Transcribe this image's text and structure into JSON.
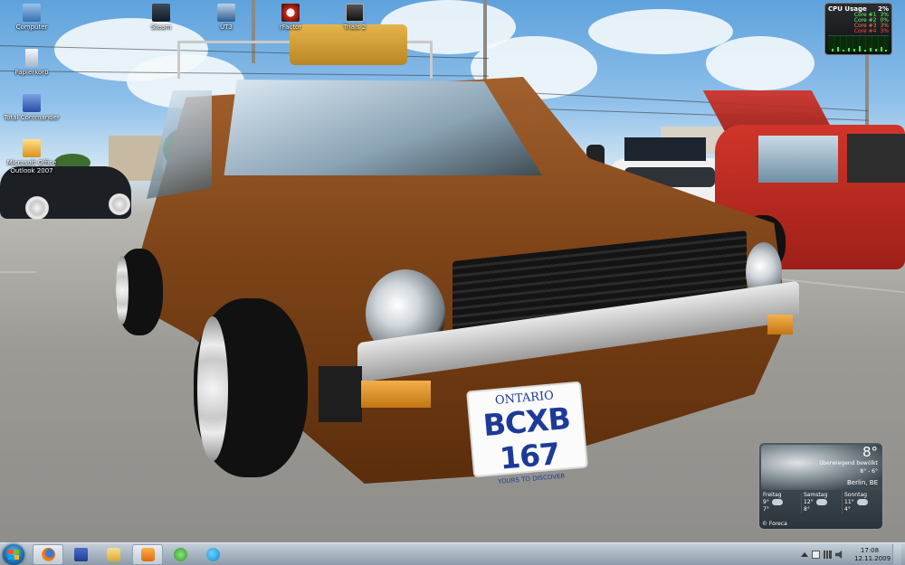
{
  "desktop": {
    "icons": [
      {
        "label": "Computer",
        "icon": "computer-icon",
        "color": "#4c86c9"
      },
      {
        "label": "Steam",
        "icon": "steam-icon",
        "color": "#1b2838"
      },
      {
        "label": "UT3",
        "icon": "ut3-icon",
        "color": "#2d5c8f"
      },
      {
        "label": "rFactor",
        "icon": "rfactor-icon",
        "color": "#c8261b"
      },
      {
        "label": "Trials 2",
        "icon": "trials2-icon",
        "color": "#222222"
      },
      {
        "label": "Papierkorb",
        "icon": "recycle-bin-icon",
        "color": "#cfd8e2"
      },
      {
        "label": "Total Commander",
        "icon": "total-commander-icon",
        "color": "#3c63b8"
      },
      {
        "label": "Microsoft Office Outlook 2007",
        "icon": "outlook-icon",
        "color": "#e3a523"
      }
    ]
  },
  "cpu_gadget": {
    "title": "CPU Usage",
    "total": "2%",
    "cores": [
      {
        "label": "Core #1",
        "value": "3%"
      },
      {
        "label": "Core #2",
        "value": "0%"
      },
      {
        "label": "Core #3",
        "value": "3%"
      },
      {
        "label": "Core #4",
        "value": "3%"
      }
    ]
  },
  "weather": {
    "temperature": "8°",
    "description": "überwiegend bewölkt",
    "range": "8° - 6°",
    "city": "Berlin, BE",
    "days": [
      {
        "name": "Freitag",
        "high": "9°",
        "low": "7°"
      },
      {
        "name": "Samstag",
        "high": "12°",
        "low": "8°"
      },
      {
        "name": "Sonntag",
        "high": "11°",
        "low": "4°"
      }
    ],
    "provider": "© Foreca"
  },
  "wallpaper": {
    "plate_top": "ONTARIO",
    "plate_number": "BCXB 167",
    "plate_slogan": "YOURS TO DISCOVER"
  },
  "taskbar": {
    "buttons": [
      {
        "icon": "firefox-icon",
        "color": "#e66a1c",
        "active": true
      },
      {
        "icon": "floppy-save-icon",
        "color": "#3853a8",
        "active": false
      },
      {
        "icon": "explorer-folder-icon",
        "color": "#e9c65a",
        "active": false
      },
      {
        "icon": "media-player-icon",
        "color": "#f08a1c",
        "active": true
      },
      {
        "icon": "clover-icon",
        "color": "#44b83a",
        "active": false
      },
      {
        "icon": "skype-icon",
        "color": "#1ea6e6",
        "active": false
      }
    ],
    "clock": {
      "time": "17:08",
      "date": "12.11.2009"
    }
  }
}
